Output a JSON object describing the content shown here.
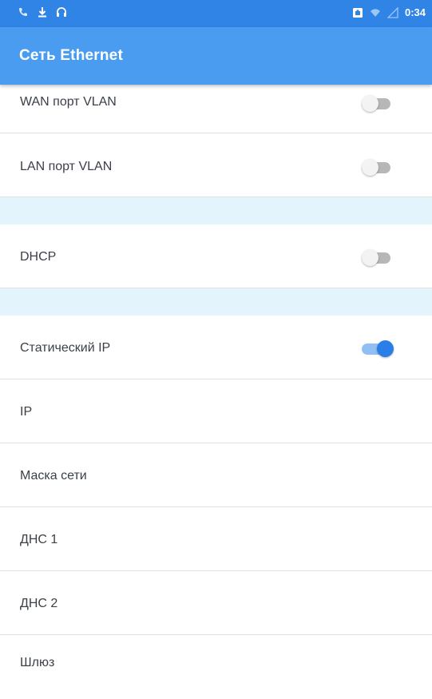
{
  "status_bar": {
    "time": "0:34",
    "left_icons": [
      "phone-icon",
      "download-icon",
      "headset-icon"
    ],
    "right_icons": [
      "ethernet-icon",
      "wifi-icon",
      "signal-icon"
    ]
  },
  "app_bar": {
    "title": "Сеть Ethernet"
  },
  "settings": {
    "wan_vlan": {
      "label": "WAN порт VLAN",
      "enabled": false
    },
    "lan_vlan": {
      "label": "LAN порт VLAN",
      "enabled": false
    },
    "dhcp": {
      "label": "DHCP",
      "enabled": false
    },
    "static_ip": {
      "label": "Статический IP",
      "enabled": true
    },
    "ip": {
      "label": "IP"
    },
    "netmask": {
      "label": "Маска сети"
    },
    "dns1": {
      "label": "ДНС 1"
    },
    "dns2": {
      "label": "ДНС 2"
    },
    "gateway": {
      "label": "Шлюз"
    }
  },
  "colors": {
    "status_bar": "#2f84e6",
    "app_bar": "#4a9cf1",
    "section_spacer": "#e3f4fd",
    "switch_on": "#2a7ee8"
  }
}
